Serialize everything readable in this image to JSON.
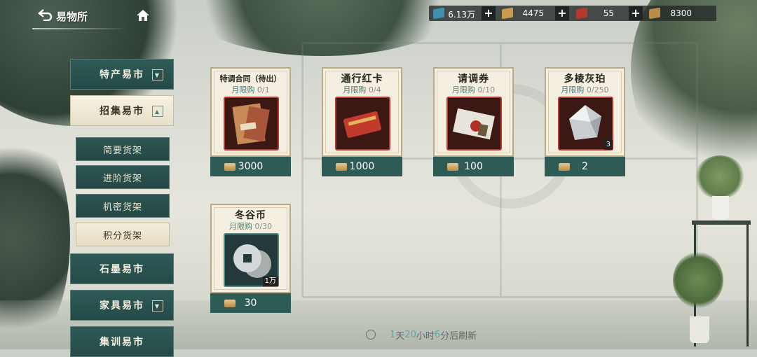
{
  "header": {
    "back_label": "易物所",
    "back_icon": "back-arrow-icon",
    "home_icon": "home-icon"
  },
  "resources": [
    {
      "icon": "blue-ticket-icon",
      "color": "#3e8fb0",
      "value": "6.13万",
      "plus": "+"
    },
    {
      "icon": "gold-ticket-icon",
      "color": "#c99b4f",
      "value": "4475",
      "plus": "+"
    },
    {
      "icon": "red-ticket-icon",
      "color": "#b5382e",
      "value": "55",
      "plus": "+"
    },
    {
      "icon": "bronze-ticket-icon",
      "color": "#b98c48",
      "value": "8300"
    }
  ],
  "nav": {
    "items": [
      {
        "label": "特产易市",
        "dropdown": "▼"
      },
      {
        "label": "招集易市",
        "dropdown": "▲"
      },
      {
        "label": "石墨易市"
      },
      {
        "label": "家具易市",
        "dropdown": "▼"
      },
      {
        "label": "集训易市"
      }
    ],
    "sub_items": [
      {
        "label": "简要货架"
      },
      {
        "label": "进阶货架"
      },
      {
        "label": "机密货架"
      },
      {
        "label": "积分货架"
      }
    ]
  },
  "shop": {
    "items": [
      {
        "name": "特调合同（待出）",
        "limit_label": "月限购",
        "limit_count": "0/1",
        "price": "3000",
        "image": "contract-folder-icon"
      },
      {
        "name": "通行红卡",
        "limit_label": "月限购",
        "limit_count": "0/4",
        "price": "1000",
        "image": "red-pass-card-icon"
      },
      {
        "name": "请调券",
        "limit_label": "月限购",
        "limit_count": "0/10",
        "price": "100",
        "image": "sealed-envelope-icon"
      },
      {
        "name": "多棱灰珀",
        "limit_label": "月限购",
        "limit_count": "0/250",
        "price": "2",
        "qty": "3",
        "image": "grey-crystal-icon"
      },
      {
        "name": "冬谷币",
        "limit_label": "月限购",
        "limit_count": "0/30",
        "price": "30",
        "qty": "1万",
        "image": "silver-coins-icon"
      }
    ],
    "currency_icon": "bronze-ticket-icon"
  },
  "refresh": {
    "d": "1",
    "d_unit": "天",
    "h": "20",
    "h_unit": "小时",
    "m": "6",
    "m_unit": "分后刷新"
  }
}
